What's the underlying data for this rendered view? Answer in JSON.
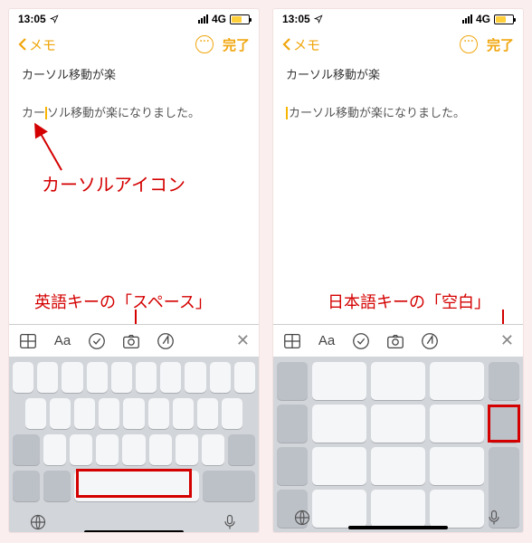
{
  "status": {
    "time": "13:05",
    "net": "4G"
  },
  "nav": {
    "back_label": "メモ",
    "done_label": "完了"
  },
  "note": {
    "title": "カーソル移動が楽",
    "body_left_pre": "カー",
    "body_left_post": "ソル移動が楽になりました。",
    "body_right": "カーソル移動が楽になりました。"
  },
  "annotations": {
    "cursor_icon": "カーソルアイコン",
    "english_space": "英語キーの「スペース」",
    "japanese_kuuhaku": "日本語キーの「空白」"
  },
  "toolbar": {
    "aa": "Aa"
  },
  "colors": {
    "accent": "#f0a60d",
    "annotation": "#d40000"
  }
}
